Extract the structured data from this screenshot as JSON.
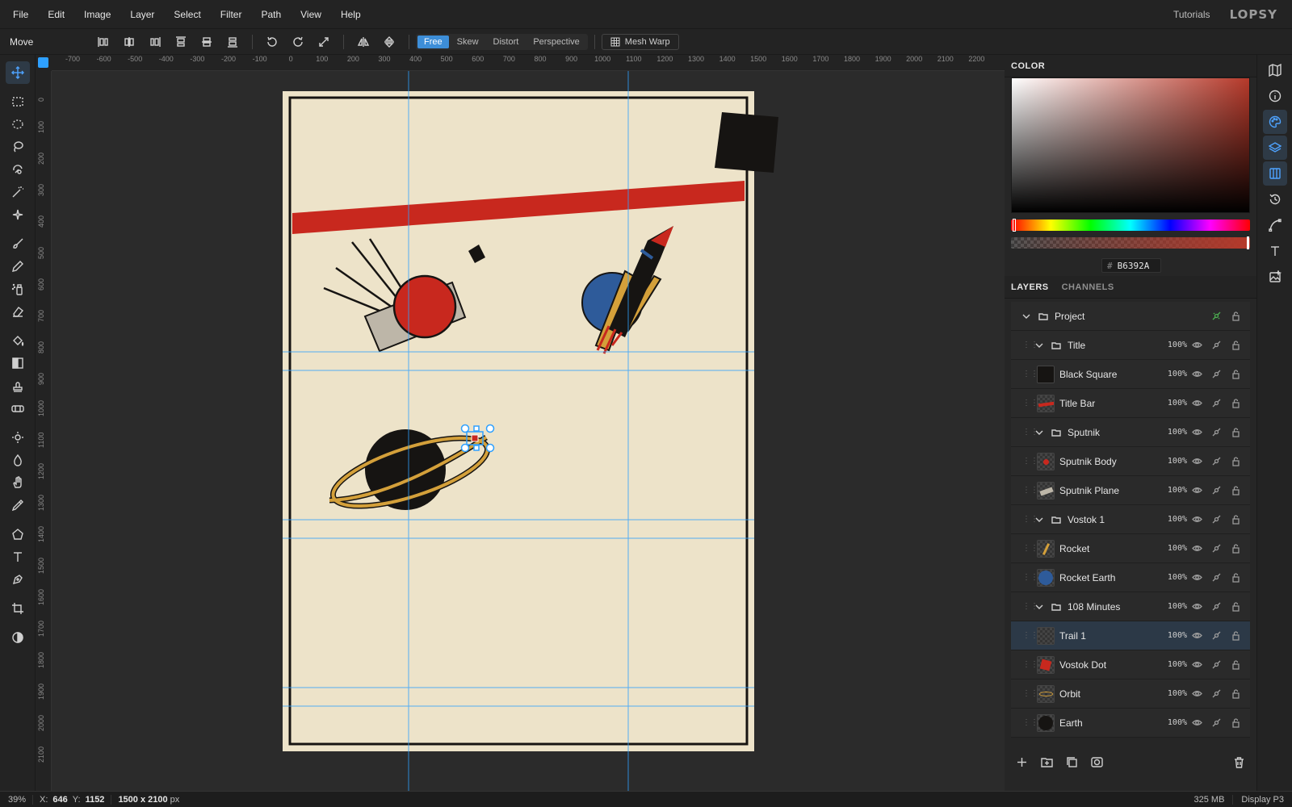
{
  "menu": [
    "File",
    "Edit",
    "Image",
    "Layer",
    "Select",
    "Filter",
    "Path",
    "View",
    "Help"
  ],
  "header": {
    "tutorials": "Tutorials",
    "brand": "LOPSY"
  },
  "options": {
    "tool_name": "Move",
    "modes": [
      "Free",
      "Skew",
      "Distort",
      "Perspective"
    ],
    "active_mode": "Free",
    "mesh_warp": "Mesh Warp"
  },
  "rulers": {
    "h_labels": [
      "-700",
      "-600",
      "-500",
      "-400",
      "-300",
      "-200",
      "-100",
      "0",
      "100",
      "200",
      "300",
      "400",
      "500",
      "600",
      "700",
      "800",
      "900",
      "1000",
      "1100",
      "1200",
      "1300",
      "1400",
      "1500",
      "1600",
      "1700",
      "1800",
      "1900",
      "2000",
      "2100",
      "2200"
    ],
    "v_labels": [
      "0",
      "100",
      "200",
      "300",
      "400",
      "500",
      "600",
      "700",
      "800",
      "900",
      "1000",
      "1100",
      "1200",
      "1300",
      "1400",
      "1500",
      "1600",
      "1700",
      "1800",
      "1900",
      "2000",
      "2100"
    ]
  },
  "color_panel": {
    "tab": "COLOR",
    "hex_label": "#",
    "hex": "B6392A",
    "color": "#b6392a"
  },
  "layers_panel": {
    "tabs": [
      "LAYERS",
      "CHANNELS"
    ],
    "active_tab": "LAYERS",
    "root": "Project",
    "rows": [
      {
        "name": "Title",
        "type": "group",
        "opacity": "100%"
      },
      {
        "name": "Black Square",
        "type": "layer",
        "opacity": "100%",
        "thumb": "black-square"
      },
      {
        "name": "Title Bar",
        "type": "layer",
        "opacity": "100%",
        "thumb": "title-bar"
      },
      {
        "name": "Sputnik",
        "type": "group",
        "opacity": "100%"
      },
      {
        "name": "Sputnik Body",
        "type": "layer",
        "opacity": "100%",
        "thumb": "sputnik-body"
      },
      {
        "name": "Sputnik Plane",
        "type": "layer",
        "opacity": "100%",
        "thumb": "sputnik-plane"
      },
      {
        "name": "Vostok 1",
        "type": "group",
        "opacity": "100%"
      },
      {
        "name": "Rocket",
        "type": "layer",
        "opacity": "100%",
        "thumb": "rocket"
      },
      {
        "name": "Rocket Earth",
        "type": "layer",
        "opacity": "100%",
        "thumb": "rocket-earth"
      },
      {
        "name": "108 Minutes",
        "type": "group",
        "opacity": "100%"
      },
      {
        "name": "Trail 1",
        "type": "layer",
        "opacity": "100%",
        "thumb": "trail",
        "selected": true
      },
      {
        "name": "Vostok Dot",
        "type": "layer",
        "opacity": "100%",
        "thumb": "vostok-dot"
      },
      {
        "name": "Orbit",
        "type": "layer",
        "opacity": "100%",
        "thumb": "orbit"
      },
      {
        "name": "Earth",
        "type": "layer",
        "opacity": "100%",
        "thumb": "earth"
      }
    ]
  },
  "status": {
    "zoom": "39%",
    "x_label": "X:",
    "x": "646",
    "y_label": "Y:",
    "y": "1152",
    "doc_size": "1500 x 2100",
    "doc_unit": "px",
    "memory": "325 MB",
    "color_profile": "Display P3"
  },
  "colors": {
    "paper": "#ede3c9",
    "red": "#c8281e",
    "black": "#161412",
    "blue": "#2e5b9a",
    "gold": "#d4a03a",
    "gray": "#bdb6a8",
    "guide": "#2ea0ff",
    "accent": "#3d8ed8"
  }
}
